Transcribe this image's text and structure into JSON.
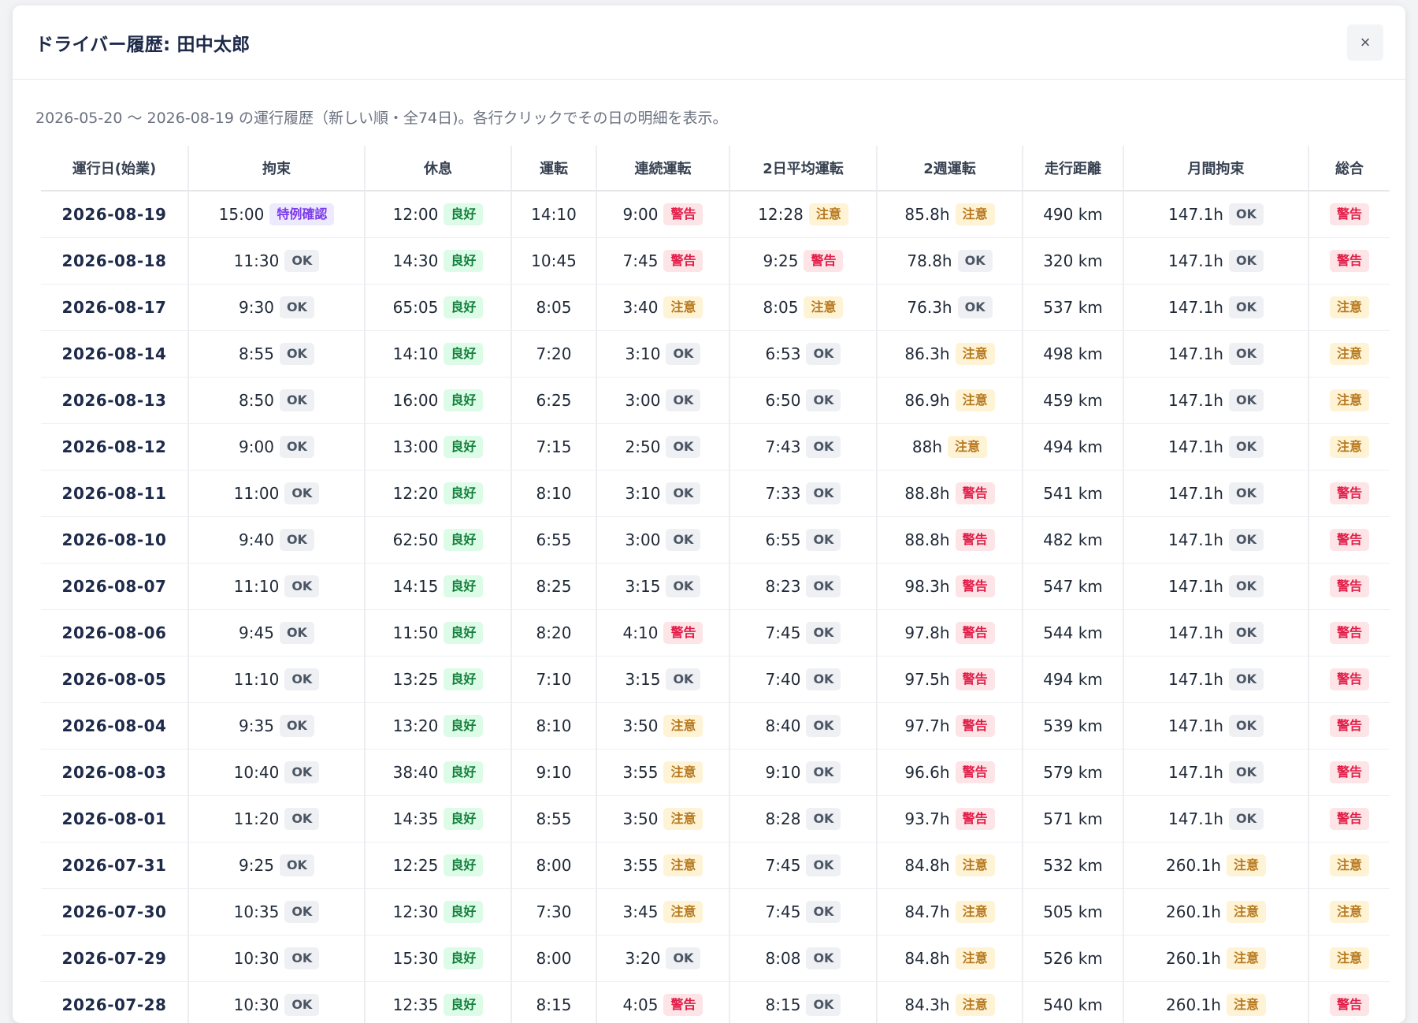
{
  "modal": {
    "title": "ドライバー履歴: 田中太郎",
    "close_label": "×",
    "subtitle": "2026-05-20 〜 2026-08-19 の運行履歴（新しい順・全74日)。各行クリックでその日の明細を表示。"
  },
  "table": {
    "headers": [
      "運行日(始業)",
      "拘束",
      "休息",
      "運転",
      "連続運転",
      "2日平均運転",
      "2週運転",
      "走行距離",
      "月間拘束",
      "総合"
    ],
    "rows": [
      {
        "date": "2026-08-19",
        "kosoku": "15:00",
        "kosoku_badge": "特例確認",
        "kyusoku": "12:00",
        "kyusoku_badge": "良好",
        "unten": "14:10",
        "renzoku": "9:00",
        "renzoku_badge": "警告",
        "avg2": "12:28",
        "avg2_badge": "注意",
        "week2": "85.8h",
        "week2_badge": "注意",
        "distance": "490 km",
        "monthly": "147.1h",
        "monthly_badge": "OK",
        "overall": "警告"
      },
      {
        "date": "2026-08-18",
        "kosoku": "11:30",
        "kosoku_badge": "OK",
        "kyusoku": "14:30",
        "kyusoku_badge": "良好",
        "unten": "10:45",
        "renzoku": "7:45",
        "renzoku_badge": "警告",
        "avg2": "9:25",
        "avg2_badge": "警告",
        "week2": "78.8h",
        "week2_badge": "OK",
        "distance": "320 km",
        "monthly": "147.1h",
        "monthly_badge": "OK",
        "overall": "警告"
      },
      {
        "date": "2026-08-17",
        "kosoku": "9:30",
        "kosoku_badge": "OK",
        "kyusoku": "65:05",
        "kyusoku_badge": "良好",
        "unten": "8:05",
        "renzoku": "3:40",
        "renzoku_badge": "注意",
        "avg2": "8:05",
        "avg2_badge": "注意",
        "week2": "76.3h",
        "week2_badge": "OK",
        "distance": "537 km",
        "monthly": "147.1h",
        "monthly_badge": "OK",
        "overall": "注意"
      },
      {
        "date": "2026-08-14",
        "kosoku": "8:55",
        "kosoku_badge": "OK",
        "kyusoku": "14:10",
        "kyusoku_badge": "良好",
        "unten": "7:20",
        "renzoku": "3:10",
        "renzoku_badge": "OK",
        "avg2": "6:53",
        "avg2_badge": "OK",
        "week2": "86.3h",
        "week2_badge": "注意",
        "distance": "498 km",
        "monthly": "147.1h",
        "monthly_badge": "OK",
        "overall": "注意"
      },
      {
        "date": "2026-08-13",
        "kosoku": "8:50",
        "kosoku_badge": "OK",
        "kyusoku": "16:00",
        "kyusoku_badge": "良好",
        "unten": "6:25",
        "renzoku": "3:00",
        "renzoku_badge": "OK",
        "avg2": "6:50",
        "avg2_badge": "OK",
        "week2": "86.9h",
        "week2_badge": "注意",
        "distance": "459 km",
        "monthly": "147.1h",
        "monthly_badge": "OK",
        "overall": "注意"
      },
      {
        "date": "2026-08-12",
        "kosoku": "9:00",
        "kosoku_badge": "OK",
        "kyusoku": "13:00",
        "kyusoku_badge": "良好",
        "unten": "7:15",
        "renzoku": "2:50",
        "renzoku_badge": "OK",
        "avg2": "7:43",
        "avg2_badge": "OK",
        "week2": "88h",
        "week2_badge": "注意",
        "distance": "494 km",
        "monthly": "147.1h",
        "monthly_badge": "OK",
        "overall": "注意"
      },
      {
        "date": "2026-08-11",
        "kosoku": "11:00",
        "kosoku_badge": "OK",
        "kyusoku": "12:20",
        "kyusoku_badge": "良好",
        "unten": "8:10",
        "renzoku": "3:10",
        "renzoku_badge": "OK",
        "avg2": "7:33",
        "avg2_badge": "OK",
        "week2": "88.8h",
        "week2_badge": "警告",
        "distance": "541 km",
        "monthly": "147.1h",
        "monthly_badge": "OK",
        "overall": "警告"
      },
      {
        "date": "2026-08-10",
        "kosoku": "9:40",
        "kosoku_badge": "OK",
        "kyusoku": "62:50",
        "kyusoku_badge": "良好",
        "unten": "6:55",
        "renzoku": "3:00",
        "renzoku_badge": "OK",
        "avg2": "6:55",
        "avg2_badge": "OK",
        "week2": "88.8h",
        "week2_badge": "警告",
        "distance": "482 km",
        "monthly": "147.1h",
        "monthly_badge": "OK",
        "overall": "警告"
      },
      {
        "date": "2026-08-07",
        "kosoku": "11:10",
        "kosoku_badge": "OK",
        "kyusoku": "14:15",
        "kyusoku_badge": "良好",
        "unten": "8:25",
        "renzoku": "3:15",
        "renzoku_badge": "OK",
        "avg2": "8:23",
        "avg2_badge": "OK",
        "week2": "98.3h",
        "week2_badge": "警告",
        "distance": "547 km",
        "monthly": "147.1h",
        "monthly_badge": "OK",
        "overall": "警告"
      },
      {
        "date": "2026-08-06",
        "kosoku": "9:45",
        "kosoku_badge": "OK",
        "kyusoku": "11:50",
        "kyusoku_badge": "良好",
        "unten": "8:20",
        "renzoku": "4:10",
        "renzoku_badge": "警告",
        "avg2": "7:45",
        "avg2_badge": "OK",
        "week2": "97.8h",
        "week2_badge": "警告",
        "distance": "544 km",
        "monthly": "147.1h",
        "monthly_badge": "OK",
        "overall": "警告"
      },
      {
        "date": "2026-08-05",
        "kosoku": "11:10",
        "kosoku_badge": "OK",
        "kyusoku": "13:25",
        "kyusoku_badge": "良好",
        "unten": "7:10",
        "renzoku": "3:15",
        "renzoku_badge": "OK",
        "avg2": "7:40",
        "avg2_badge": "OK",
        "week2": "97.5h",
        "week2_badge": "警告",
        "distance": "494 km",
        "monthly": "147.1h",
        "monthly_badge": "OK",
        "overall": "警告"
      },
      {
        "date": "2026-08-04",
        "kosoku": "9:35",
        "kosoku_badge": "OK",
        "kyusoku": "13:20",
        "kyusoku_badge": "良好",
        "unten": "8:10",
        "renzoku": "3:50",
        "renzoku_badge": "注意",
        "avg2": "8:40",
        "avg2_badge": "OK",
        "week2": "97.7h",
        "week2_badge": "警告",
        "distance": "539 km",
        "monthly": "147.1h",
        "monthly_badge": "OK",
        "overall": "警告"
      },
      {
        "date": "2026-08-03",
        "kosoku": "10:40",
        "kosoku_badge": "OK",
        "kyusoku": "38:40",
        "kyusoku_badge": "良好",
        "unten": "9:10",
        "renzoku": "3:55",
        "renzoku_badge": "注意",
        "avg2": "9:10",
        "avg2_badge": "OK",
        "week2": "96.6h",
        "week2_badge": "警告",
        "distance": "579 km",
        "monthly": "147.1h",
        "monthly_badge": "OK",
        "overall": "警告"
      },
      {
        "date": "2026-08-01",
        "kosoku": "11:20",
        "kosoku_badge": "OK",
        "kyusoku": "14:35",
        "kyusoku_badge": "良好",
        "unten": "8:55",
        "renzoku": "3:50",
        "renzoku_badge": "注意",
        "avg2": "8:28",
        "avg2_badge": "OK",
        "week2": "93.7h",
        "week2_badge": "警告",
        "distance": "571 km",
        "monthly": "147.1h",
        "monthly_badge": "OK",
        "overall": "警告"
      },
      {
        "date": "2026-07-31",
        "kosoku": "9:25",
        "kosoku_badge": "OK",
        "kyusoku": "12:25",
        "kyusoku_badge": "良好",
        "unten": "8:00",
        "renzoku": "3:55",
        "renzoku_badge": "注意",
        "avg2": "7:45",
        "avg2_badge": "OK",
        "week2": "84.8h",
        "week2_badge": "注意",
        "distance": "532 km",
        "monthly": "260.1h",
        "monthly_badge": "注意",
        "overall": "注意"
      },
      {
        "date": "2026-07-30",
        "kosoku": "10:35",
        "kosoku_badge": "OK",
        "kyusoku": "12:30",
        "kyusoku_badge": "良好",
        "unten": "7:30",
        "renzoku": "3:45",
        "renzoku_badge": "注意",
        "avg2": "7:45",
        "avg2_badge": "OK",
        "week2": "84.7h",
        "week2_badge": "注意",
        "distance": "505 km",
        "monthly": "260.1h",
        "monthly_badge": "注意",
        "overall": "注意"
      },
      {
        "date": "2026-07-29",
        "kosoku": "10:30",
        "kosoku_badge": "OK",
        "kyusoku": "15:30",
        "kyusoku_badge": "良好",
        "unten": "8:00",
        "renzoku": "3:20",
        "renzoku_badge": "OK",
        "avg2": "8:08",
        "avg2_badge": "OK",
        "week2": "84.8h",
        "week2_badge": "注意",
        "distance": "526 km",
        "monthly": "260.1h",
        "monthly_badge": "注意",
        "overall": "注意"
      },
      {
        "date": "2026-07-28",
        "kosoku": "10:30",
        "kosoku_badge": "OK",
        "kyusoku": "12:35",
        "kyusoku_badge": "良好",
        "unten": "8:15",
        "renzoku": "4:05",
        "renzoku_badge": "警告",
        "avg2": "8:15",
        "avg2_badge": "OK",
        "week2": "84.3h",
        "week2_badge": "注意",
        "distance": "540 km",
        "monthly": "260.1h",
        "monthly_badge": "注意",
        "overall": "警告"
      }
    ]
  },
  "colors": {
    "ok": "#4b5563",
    "good": "#15803d",
    "caution": "#b7791f",
    "warning": "#e11d48",
    "special": "#7c3aed"
  }
}
